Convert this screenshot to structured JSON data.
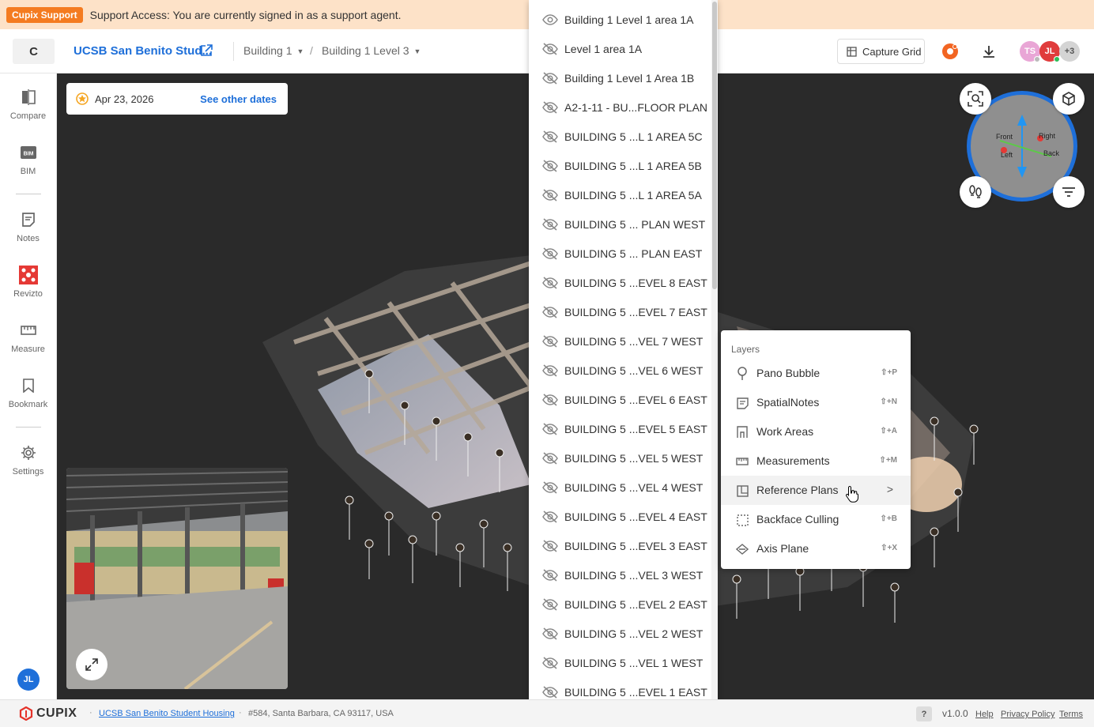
{
  "banner": {
    "tag": "Cupix Support",
    "message": "Support Access: You are currently signed in as a support agent."
  },
  "header": {
    "project_initial": "C",
    "project_name": "UCSB San Benito Stud...",
    "crumb_building": "Building 1",
    "crumb_separator": "/",
    "crumb_level": "Building 1 Level 3",
    "capture_grid_label": "Capture Grid",
    "avatars": [
      {
        "initials": "TS",
        "color": "#e9a6d6"
      },
      {
        "initials": "JL",
        "color": "#e03c3c"
      },
      {
        "initials": "+3",
        "color": "#cfcfcf"
      }
    ]
  },
  "sidebar": {
    "items": [
      {
        "label": "Compare",
        "icon": "compare-icon"
      },
      {
        "label": "BIM",
        "icon": "bim-icon"
      },
      {
        "label": "Notes",
        "icon": "notes-icon"
      },
      {
        "label": "Revizto",
        "icon": "revizto-icon"
      },
      {
        "label": "Measure",
        "icon": "measure-icon"
      },
      {
        "label": "Bookmark",
        "icon": "bookmark-icon"
      },
      {
        "label": "Settings",
        "icon": "gear-icon"
      }
    ],
    "user_initials": "JL"
  },
  "viewport": {
    "date": "Apr 23, 2026",
    "see_other_dates": "See other dates",
    "compass_labels": {
      "front": "Front",
      "right": "Right",
      "left": "Left",
      "back": "Back"
    }
  },
  "plans": {
    "items": [
      {
        "label": "Building 1 Level 1 area 1A",
        "visible": true
      },
      {
        "label": "Level 1 area 1A",
        "visible": false
      },
      {
        "label": "Building 1 Level 1 Area 1B",
        "visible": false
      },
      {
        "label": "A2-1-11 - BU...FLOOR PLAN",
        "visible": false
      },
      {
        "label": "BUILDING 5 ...L 1 AREA 5C",
        "visible": false
      },
      {
        "label": "BUILDING 5 ...L 1 AREA 5B",
        "visible": false
      },
      {
        "label": "BUILDING 5 ...L 1 AREA 5A",
        "visible": false
      },
      {
        "label": "BUILDING 5 ... PLAN WEST",
        "visible": false
      },
      {
        "label": "BUILDING 5 ... PLAN EAST",
        "visible": false
      },
      {
        "label": "BUILDING 5 ...EVEL 8 EAST",
        "visible": false
      },
      {
        "label": "BUILDING 5 ...EVEL 7 EAST",
        "visible": false
      },
      {
        "label": "BUILDING 5 ...VEL 7 WEST",
        "visible": false
      },
      {
        "label": "BUILDING 5 ...VEL 6 WEST",
        "visible": false
      },
      {
        "label": "BUILDING 5 ...EVEL 6 EAST",
        "visible": false
      },
      {
        "label": "BUILDING 5 ...EVEL 5 EAST",
        "visible": false
      },
      {
        "label": "BUILDING 5 ...VEL 5 WEST",
        "visible": false
      },
      {
        "label": "BUILDING 5 ...VEL 4 WEST",
        "visible": false
      },
      {
        "label": "BUILDING 5 ...EVEL 4 EAST",
        "visible": false
      },
      {
        "label": "BUILDING 5 ...EVEL 3 EAST",
        "visible": false
      },
      {
        "label": "BUILDING 5 ...VEL 3 WEST",
        "visible": false
      },
      {
        "label": "BUILDING 5 ...EVEL 2 EAST",
        "visible": false
      },
      {
        "label": "BUILDING 5 ...VEL 2 WEST",
        "visible": false
      },
      {
        "label": "BUILDING 5 ...VEL 1 WEST",
        "visible": false
      },
      {
        "label": "BUILDING 5 ...EVEL 1 EAST",
        "visible": false
      }
    ]
  },
  "layers": {
    "heading": "Layers",
    "items": [
      {
        "label": "Pano Bubble",
        "shortcut": "⇧+P",
        "icon": "pano-bubble-icon"
      },
      {
        "label": "SpatialNotes",
        "shortcut": "⇧+N",
        "icon": "spatial-notes-icon"
      },
      {
        "label": "Work Areas",
        "shortcut": "⇧+A",
        "icon": "work-areas-icon"
      },
      {
        "label": "Measurements",
        "shortcut": "⇧+M",
        "icon": "measurements-icon"
      },
      {
        "label": "Reference Plans",
        "shortcut": ">",
        "icon": "reference-plans-icon"
      },
      {
        "label": "Backface Culling",
        "shortcut": "⇧+B",
        "icon": "backface-culling-icon"
      },
      {
        "label": "Axis Plane",
        "shortcut": "⇧+X",
        "icon": "axis-plane-icon"
      }
    ]
  },
  "footer": {
    "brand": "CUPIX",
    "project_link": "UCSB San Benito Student Housing",
    "address": "#584, Santa Barbara, CA 93117, USA",
    "help_badge": "?",
    "version": "v1.0.0",
    "help": "Help",
    "privacy": "Privacy Policy",
    "terms": "Terms"
  },
  "colors": {
    "accent": "#1e6fd9",
    "support_banner": "#fde2c8",
    "support_tag": "#f47b20",
    "revizto": "#e53935"
  }
}
